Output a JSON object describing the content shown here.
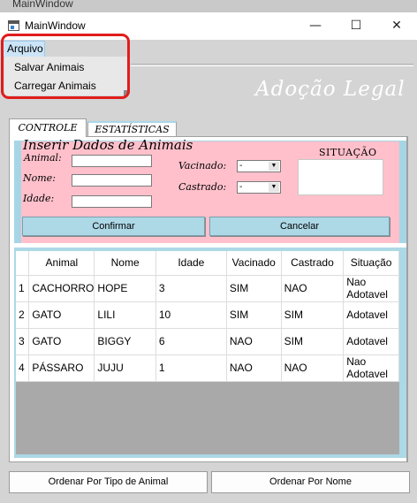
{
  "window": {
    "background_title": "MainWindow",
    "title": "MainWindow",
    "minimize_glyph": "—",
    "maximize_glyph": "☐",
    "close_glyph": "✕"
  },
  "menu": {
    "arquivo": "Arquivo",
    "items": [
      "Salvar Animais",
      "Carregar Animais"
    ]
  },
  "logo": "Adoção Legal",
  "tabs": [
    "CONTROLE",
    "ESTATÍSTICAS"
  ],
  "form": {
    "title": "Inserir Dados de Animais",
    "animal_label": "Animal:",
    "nome_label": "Nome:",
    "idade_label": "Idade:",
    "vacinado_label": "Vacinado:",
    "castrado_label": "Castrado:",
    "vacinado_value": "-",
    "castrado_value": "-",
    "situacao_label": "SITUAÇÃO",
    "confirm": "Confirmar",
    "cancel": "Cancelar"
  },
  "table": {
    "headers": [
      "Animal",
      "Nome",
      "Idade",
      "Vacinado",
      "Castrado",
      "Situação"
    ],
    "rows": [
      {
        "n": "1",
        "animal": "CACHORRO",
        "nome": "HOPE",
        "idade": "3",
        "vacinado": "SIM",
        "castrado": "NAO",
        "situacao": "Nao Adotavel"
      },
      {
        "n": "2",
        "animal": "GATO",
        "nome": "LILI",
        "idade": "10",
        "vacinado": "SIM",
        "castrado": "SIM",
        "situacao": "Adotavel"
      },
      {
        "n": "3",
        "animal": "GATO",
        "nome": "BIGGY",
        "idade": "6",
        "vacinado": "NAO",
        "castrado": "SIM",
        "situacao": "Adotavel"
      },
      {
        "n": "4",
        "animal": "PÁSSARO",
        "nome": "JUJU",
        "idade": "1",
        "vacinado": "NAO",
        "castrado": "NAO",
        "situacao": "Nao Adotavel"
      }
    ]
  },
  "bottom": {
    "sort_type": "Ordenar Por Tipo de Animal",
    "sort_name": "Ordenar Por Nome"
  },
  "colors": {
    "form_bg": "#ffc0cb",
    "accent_blue": "#add8e6",
    "highlight_red": "#e11c1c",
    "menu_selected": "#cce4f7"
  },
  "icons": {
    "app": "window-app-icon",
    "dropdown_arrow": "chevron-down-icon"
  }
}
